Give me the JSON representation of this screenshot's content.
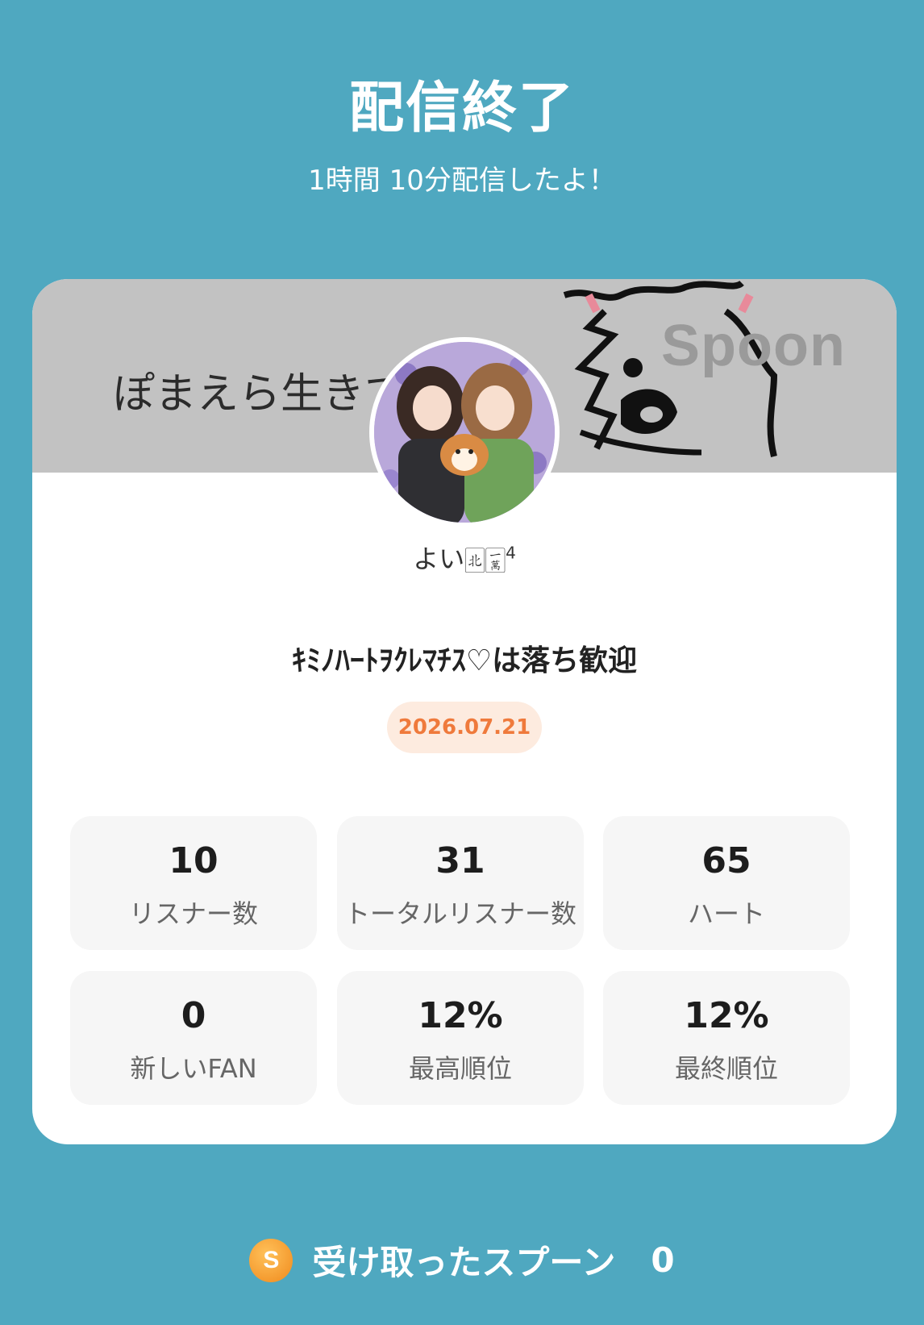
{
  "header": {
    "title": "配信終了",
    "subtitle": "1時間 10分配信したよ！"
  },
  "card": {
    "banner_text": "ぽまえら生きて",
    "banner_watermark": "Spoon",
    "username": "よい🀃🀇",
    "username_sup": "4",
    "live_title": "ｷﾐﾉﾊｰﾄｦｸﾚﾏﾁｽ♡は落ち歓迎",
    "date": "2026.07.21"
  },
  "stats": [
    {
      "value": "10",
      "label": "リスナー数"
    },
    {
      "value": "31",
      "label": "トータルリスナー数"
    },
    {
      "value": "65",
      "label": "ハート"
    },
    {
      "value": "0",
      "label": "新しいFAN"
    },
    {
      "value": "12%",
      "label": "最高順位"
    },
    {
      "value": "12%",
      "label": "最終順位"
    }
  ],
  "footer": {
    "coin_letter": "S",
    "label": "受け取ったスプーン",
    "count": "0"
  },
  "colors": {
    "background": "#4fa8c0",
    "date_text": "#ef7a3c",
    "date_bg": "#fdebdf",
    "stat_bg": "#f6f6f6"
  }
}
